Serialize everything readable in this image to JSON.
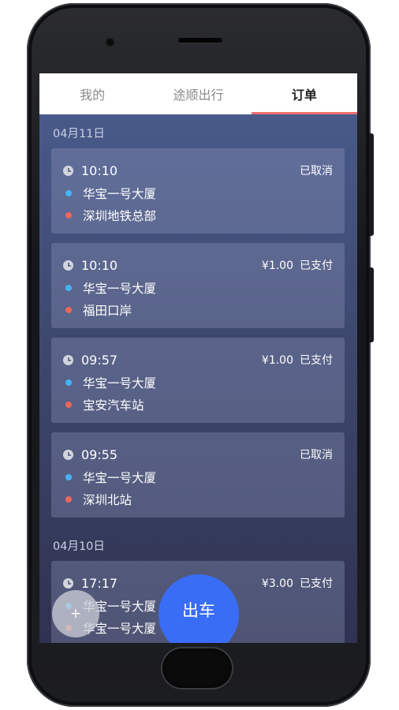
{
  "tabs": [
    {
      "label": "我的",
      "active": false
    },
    {
      "label": "途顺出行",
      "active": false
    },
    {
      "label": "订单",
      "active": true
    }
  ],
  "groups": [
    {
      "date": "04月11日",
      "orders": [
        {
          "time": "10:10",
          "from": "华宝一号大厦",
          "to": "深圳地铁总部",
          "price": "",
          "status": "已取消"
        },
        {
          "time": "10:10",
          "from": "华宝一号大厦",
          "to": "福田口岸",
          "price": "¥1.00",
          "status": "已支付"
        },
        {
          "time": "09:57",
          "from": "华宝一号大厦",
          "to": "宝安汽车站",
          "price": "¥1.00",
          "status": "已支付"
        },
        {
          "time": "09:55",
          "from": "华宝一号大厦",
          "to": "深圳北站",
          "price": "",
          "status": "已取消"
        }
      ]
    },
    {
      "date": "04月10日",
      "orders": [
        {
          "time": "17:17",
          "from": "华宝一号大厦",
          "to": "华宝一号大厦",
          "price": "¥3.00",
          "status": "已支付"
        }
      ]
    }
  ],
  "fab": {
    "add_label": "+",
    "go_label": "出车"
  },
  "colors": {
    "accent": "#3a6df5",
    "tab_indicator": "#f07070",
    "origin_dot": "#45b4f4",
    "dest_dot": "#f0665a"
  }
}
